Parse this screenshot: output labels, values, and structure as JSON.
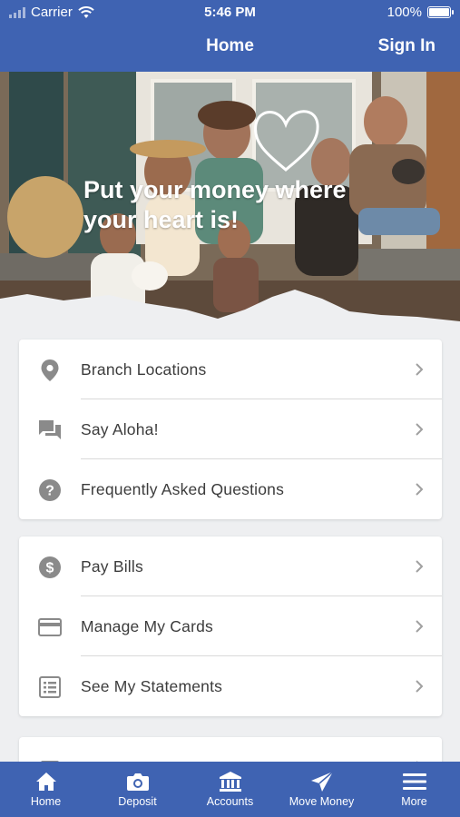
{
  "status_bar": {
    "carrier": "Carrier",
    "time": "5:46 PM",
    "battery": "100%"
  },
  "nav": {
    "title": "Home",
    "sign_in": "Sign In"
  },
  "hero": {
    "headline_line1": "Put your money where",
    "headline_line2": "your heart is!"
  },
  "card1": {
    "items": [
      {
        "label": "Branch Locations",
        "icon": "location-pin-icon"
      },
      {
        "label": "Say Aloha!",
        "icon": "chat-icon"
      },
      {
        "label": "Frequently Asked Questions",
        "icon": "help-circle-icon"
      }
    ]
  },
  "card2": {
    "items": [
      {
        "label": "Pay Bills",
        "icon": "dollar-circle-icon"
      },
      {
        "label": "Manage My Cards",
        "icon": "credit-card-icon"
      },
      {
        "label": "See My Statements",
        "icon": "statement-list-icon"
      }
    ]
  },
  "tabbar": {
    "items": [
      {
        "label": "Home",
        "icon": "home-icon"
      },
      {
        "label": "Deposit",
        "icon": "camera-icon"
      },
      {
        "label": "Accounts",
        "icon": "bank-icon"
      },
      {
        "label": "Move Money",
        "icon": "send-icon"
      },
      {
        "label": "More",
        "icon": "menu-icon"
      }
    ]
  },
  "colors": {
    "brand_blue": "#3f63b2",
    "icon_gray": "#8a8a8a",
    "text_dark": "#3c3c3c"
  }
}
